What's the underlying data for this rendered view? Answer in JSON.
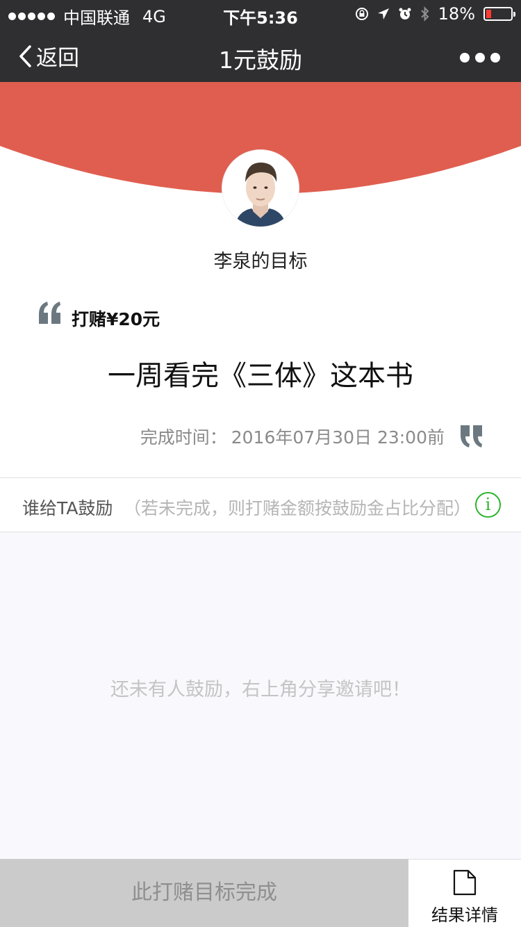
{
  "status_bar": {
    "carrier": "中国联通",
    "network": "4G",
    "time": "下午5:36",
    "battery": "18%",
    "battery_level": 0.18
  },
  "nav": {
    "back_label": "返回",
    "title": "1元鼓励"
  },
  "goal": {
    "owner": "李泉的目标",
    "bet": "打赌¥20元",
    "text": "一周看完《三体》这本书",
    "deadline_label": "完成时间：",
    "deadline_value": "2016年07月30日 23:00前"
  },
  "encourage": {
    "title": "谁给TA鼓励",
    "note": "（若未完成，则打赌金额按鼓励金占比分配）",
    "empty_text": "还未有人鼓励，右上角分享邀请吧！"
  },
  "bottom": {
    "complete_label": "此打赌目标完成",
    "details_label": "结果详情"
  },
  "colors": {
    "accent_red": "#e05e4f",
    "info_green": "#2db52d",
    "bar_dark": "#2f2f31"
  }
}
